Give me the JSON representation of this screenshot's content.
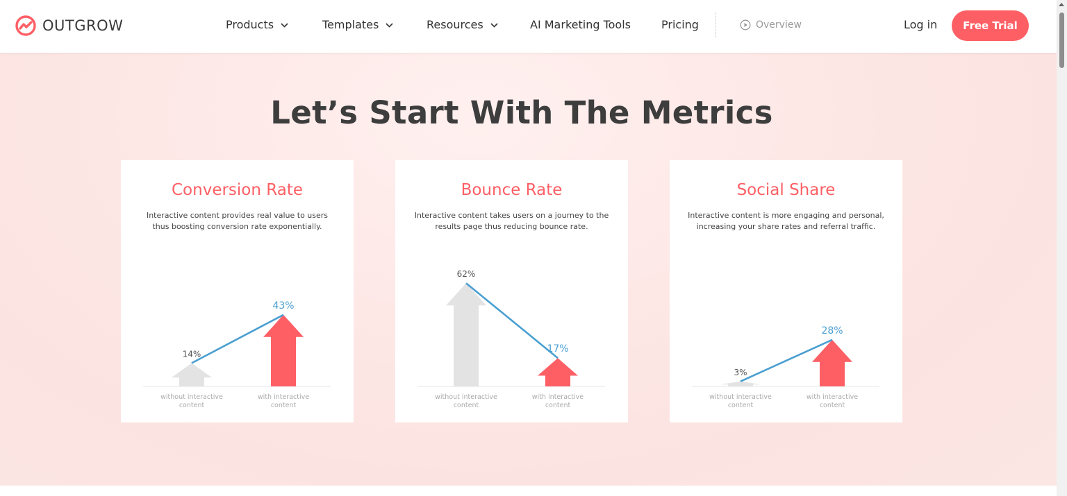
{
  "nav": {
    "logo_text": "OUTGROW",
    "products": "Products",
    "templates": "Templates",
    "resources": "Resources",
    "ai_tools": "AI Marketing Tools",
    "pricing": "Pricing",
    "overview": "Overview",
    "login": "Log in",
    "free_trial": "Free Trial"
  },
  "hero": {
    "title": "Let’s Start With The Metrics"
  },
  "cards": [
    {
      "title": "Conversion Rate",
      "desc_line1": "Interactive content provides real value to users",
      "desc_line2": "thus boosting conversion rate exponentially."
    },
    {
      "title": "Bounce Rate",
      "desc_line1": "Interactive content takes users on a journey to the",
      "desc_line2": "results page thus reducing bounce rate."
    },
    {
      "title": "Social Share",
      "desc_line1": "Interactive content is more engaging and personal,",
      "desc_line2": "increasing your share rates and referral traffic."
    }
  ],
  "colors": {
    "accent": "#fd5f65",
    "line": "#4a9fd1",
    "gray_bar": "#e3e3e3"
  },
  "chart_data": [
    {
      "type": "bar",
      "categories": [
        "without interactive content",
        "with interactive content"
      ],
      "values": [
        14,
        43
      ],
      "labels": [
        "14%",
        "43%"
      ]
    },
    {
      "type": "bar",
      "categories": [
        "without interactive content",
        "with interactive content"
      ],
      "values": [
        62,
        17
      ],
      "labels": [
        "62%",
        "17%"
      ]
    },
    {
      "type": "bar",
      "categories": [
        "without interactive content",
        "with interactive content"
      ],
      "values": [
        3,
        28
      ],
      "labels": [
        "3%",
        "28%"
      ]
    }
  ]
}
